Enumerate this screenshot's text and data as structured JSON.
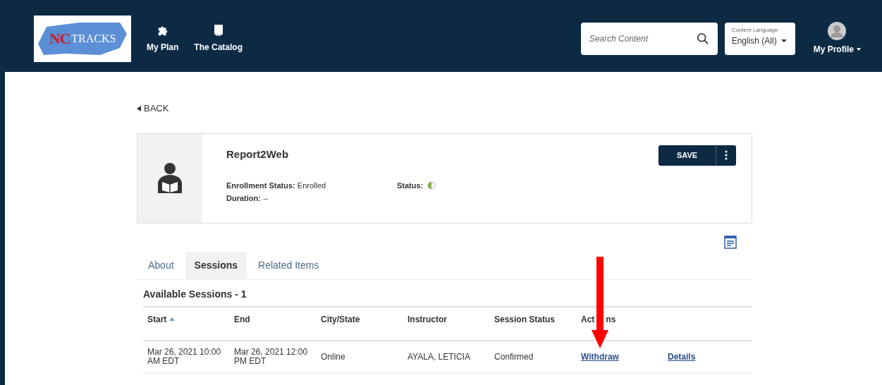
{
  "logo": {
    "text_1": "NC",
    "text_2": "TRACKS"
  },
  "nav": [
    {
      "label": "My Plan"
    },
    {
      "label": "The Catalog"
    }
  ],
  "search": {
    "placeholder": "Search Content"
  },
  "language": {
    "label": "Content Language",
    "value": "English (All)"
  },
  "profile": {
    "label": "My Profile"
  },
  "back": "BACK",
  "course": {
    "title": "Report2Web",
    "enrollment_label": "Enrollment Status:",
    "enrollment_value": "Enrolled",
    "duration_label": "Duration:",
    "duration_value": "--",
    "status_label": "Status:",
    "save": "SAVE"
  },
  "tabs": [
    {
      "label": "About",
      "selected": false
    },
    {
      "label": "Sessions",
      "selected": true
    },
    {
      "label": "Related Items",
      "selected": false
    }
  ],
  "sessions_title": "Available Sessions - 1",
  "table": {
    "columns": [
      {
        "label": "Start",
        "sorted": true
      },
      {
        "label": "End",
        "sorted": false
      },
      {
        "label": "City/State",
        "sorted": false
      },
      {
        "label": "Instructor",
        "sorted": false
      },
      {
        "label": "Session Status",
        "sorted": false
      },
      {
        "label": "Act",
        "label_rest": "ns",
        "sorted": false
      }
    ],
    "rows": [
      {
        "start": "Mar 26, 2021 10:00 AM EDT",
        "end": "Mar 26, 2021 12:00 PM EDT",
        "city": "Online",
        "instructor": "AYALA, LETICIA",
        "status": "Confirmed",
        "actions": [
          "Withdraw",
          "Details"
        ]
      }
    ]
  }
}
